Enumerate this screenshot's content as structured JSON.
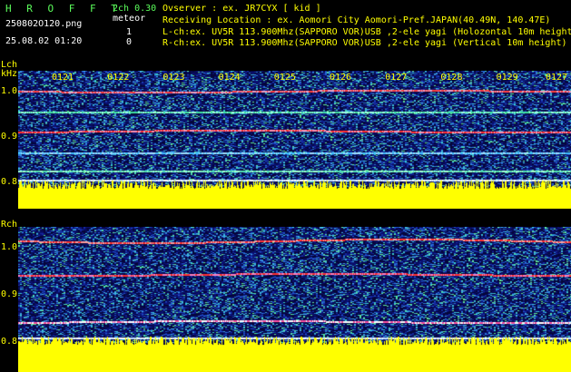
{
  "header": {
    "title": "H R O F F T",
    "file_name": "250802O120.png",
    "datetime": "25.08.02 01:20",
    "mode": "2ch 0.30",
    "meteor_label": "meteor",
    "meteor_l_count": "1",
    "meteor_r_count": "0",
    "observer_line": "Ovserver           : ex. JR7CYX [ kid ]",
    "location_line": "Receiving Location : ex. Aomori City Aomori-Pref.JAPAN(40.49N, 140.47E)",
    "lch_line": "L-ch:ex. UV5R 113.900Mhz(SAPPORO VOR)USB ,2-ele yagi (Holozontal 10m height)",
    "rch_line": "R-ch:ex. UV5R 113.900Mhz(SAPPORO VOR)USB ,2-ele yagi (Vertical 10m height)"
  },
  "lch": {
    "label": "Lch",
    "unit": "kHz",
    "y_ticks": [
      "1.0",
      "0.9",
      "0.8"
    ],
    "time_ticks": [
      "0121",
      "0122",
      "0123",
      "0124",
      "0125",
      "0126",
      "0127",
      "0128",
      "0129",
      "0127"
    ]
  },
  "rch": {
    "label": "Rch",
    "y_ticks": [
      "1.0",
      "0.9",
      "0.8"
    ]
  },
  "colors": {
    "background": "#000000",
    "text_green": "#5cff5c",
    "text_yellow": "#ffff00",
    "noise_floor": "#ffff00",
    "carrier": "#ff3030"
  }
}
